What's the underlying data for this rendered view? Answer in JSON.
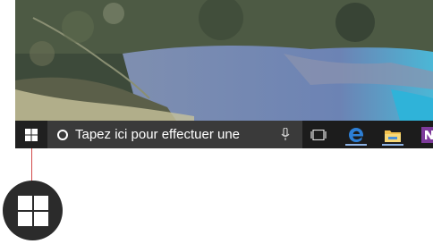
{
  "taskbar": {
    "start_icon": "windows-logo-icon",
    "search_icon": "cortana-circle-icon",
    "search_text": "Tapez ici pour effectuer une",
    "mic_icon": "microphone-icon",
    "taskview_icon": "task-view-icon",
    "apps": [
      {
        "name": "edge-icon",
        "color": "#2d7fd6"
      },
      {
        "name": "file-explorer-icon",
        "color": "#f2c14e"
      },
      {
        "name": "onenote-icon",
        "color": "#7d3b9b"
      }
    ]
  },
  "callout": {
    "icon": "windows-logo-icon",
    "line_color": "#d24b4b"
  }
}
